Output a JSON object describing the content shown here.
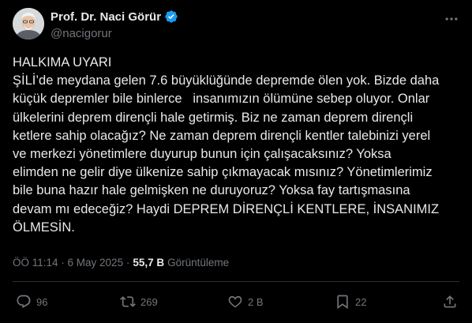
{
  "author": {
    "name": "Prof. Dr. Naci Görür",
    "handle": "@nacigorur",
    "avatar_icon": "profile-photo",
    "verified_icon": "verified-badge-icon",
    "verified_color": "#1d9bf0"
  },
  "tweet": {
    "text": "HALKIMA UYARI\nŞİLİ’de meydana gelen 7.6 büyüklüğünde depremde ölen yok. Bizde daha\nküçük depremler bile binlerce   insanımızın ölümüne sebep oluyor. Onlar\nülkelerini deprem dirençli hale getirmiş. Biz ne zaman deprem dirençli\nketlere sahip olacağız? Ne zaman deprem dirençli kentler talebinizi yerel\nve merkezi yönetimlere duyurup bunun için çalışacaksınız? Yoksa\nelimden ne gelir diye ülkenize sahip çıkmayacak mısınız? Yönetimlerimiz\nbile buna hazır hale gelmişken ne duruyoruz? Yoksa fay tartışmasına\ndevam mı edeceğiz? Haydi DEPREM DİRENÇLİ KENTLERE, İNSANIMIZ\nÖLMESİN.",
    "timestamp": "ÖÖ 11:14 · 6 May 2025 · ",
    "views_count": "55,7 B",
    "views_label": "Görüntüleme"
  },
  "actions": {
    "reply_count": "96",
    "retweet_count": "269",
    "like_count": "2 B",
    "bookmark_count": "22"
  },
  "colors": {
    "background": "#000000",
    "text": "#e7e9ea",
    "secondary": "#71767b",
    "divider": "#2f3336"
  }
}
